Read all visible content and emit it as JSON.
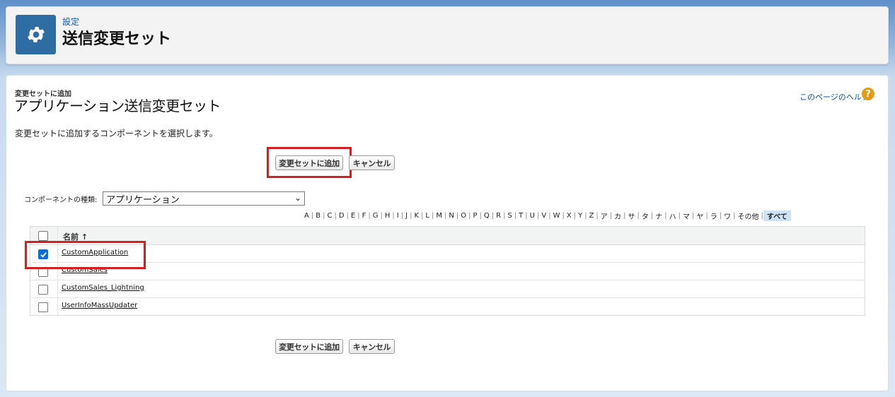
{
  "header": {
    "eyebrow": "設定",
    "title": "送信変更セット",
    "icon": "gear-icon"
  },
  "main": {
    "eyebrow": "変更セットに追加",
    "title": "アプリケーション送信変更セット",
    "help_link": "このページのヘルプ",
    "help_icon": "?",
    "description": "変更セットに追加するコンポーネントを選択します。",
    "buttons": {
      "add": "変更セットに追加",
      "cancel": "キャンセル"
    },
    "component_type": {
      "label": "コンポーネントの種類:",
      "value": "アプリケーション"
    },
    "alphabet": [
      "A",
      "B",
      "C",
      "D",
      "E",
      "F",
      "G",
      "H",
      "I",
      "J",
      "K",
      "L",
      "M",
      "N",
      "O",
      "P",
      "Q",
      "R",
      "S",
      "T",
      "U",
      "V",
      "W",
      "X",
      "Y",
      "Z",
      "ア",
      "カ",
      "サ",
      "タ",
      "ナ",
      "ハ",
      "マ",
      "ヤ",
      "ラ",
      "ワ",
      "その他",
      "すべて"
    ],
    "table": {
      "header": "名前 ↑",
      "rows": [
        {
          "name": "CustomApplication",
          "checked": true
        },
        {
          "name": "CustomSales",
          "checked": false
        },
        {
          "name": "CustomSales_Lightning",
          "checked": false
        },
        {
          "name": "UserInfoMassUpdater",
          "checked": false
        }
      ]
    }
  },
  "colors": {
    "accent": "#2e6da4",
    "highlight": "#d42020",
    "checkbox": "#0a6edc"
  }
}
